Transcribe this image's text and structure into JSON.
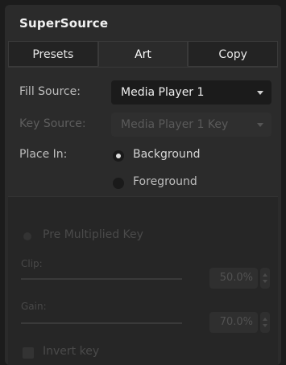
{
  "panel": {
    "title": "SuperSource"
  },
  "tabs": [
    {
      "label": "Presets",
      "active": false
    },
    {
      "label": "Art",
      "active": true
    },
    {
      "label": "Copy",
      "active": false
    }
  ],
  "fill_source": {
    "label": "Fill Source:",
    "value": "Media Player 1"
  },
  "key_source": {
    "label": "Key Source:",
    "value": "Media Player 1 Key",
    "disabled": true
  },
  "place_in": {
    "label": "Place In:",
    "options": [
      {
        "label": "Background",
        "selected": true
      },
      {
        "label": "Foreground",
        "selected": false
      }
    ]
  },
  "pre_multiplied": {
    "label": "Pre Multiplied Key",
    "enabled": false
  },
  "clip": {
    "label": "Clip:",
    "value": "50.0%"
  },
  "gain": {
    "label": "Gain:",
    "value": "70.0%"
  },
  "invert_key": {
    "label": "Invert key",
    "checked": false
  },
  "colors": {
    "background": "#2b2b2b",
    "dropdown": "#1b1b1b",
    "text": "#f0f0f0",
    "label": "#bdbdbd",
    "disabled": "#4a4a4a"
  }
}
